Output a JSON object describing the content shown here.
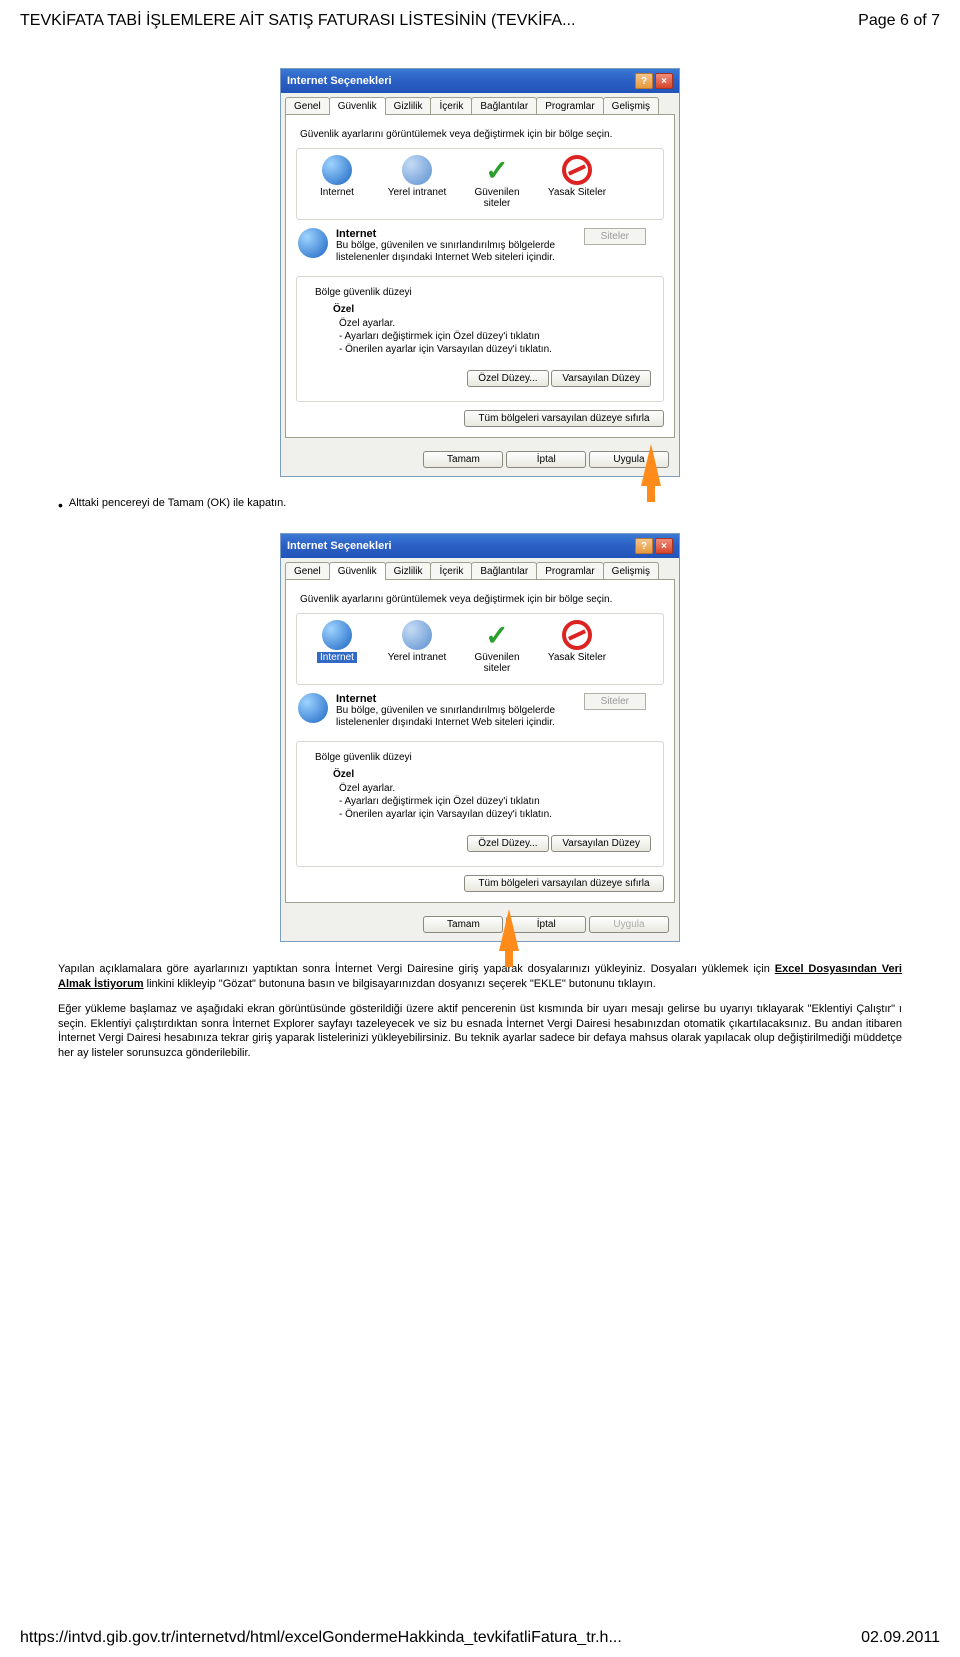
{
  "header": {
    "title": "TEVKİFATA TABİ İŞLEMLERE AİT SATIŞ FATURASI LİSTESİNİN (TEVKİFA...",
    "page_label": "Page 6 of 7"
  },
  "dialog": {
    "title": "Internet Seçenekleri",
    "help": "?",
    "close": "×",
    "tabs": [
      "Genel",
      "Güvenlik",
      "Gizlilik",
      "İçerik",
      "Bağlantılar",
      "Programlar",
      "Gelişmiş"
    ],
    "zone_instruction": "Güvenlik ayarlarını görüntülemek veya değiştirmek için bir bölge seçin.",
    "zones": [
      {
        "label": "Internet"
      },
      {
        "label": "Yerel intranet"
      },
      {
        "label": "Güvenilen siteler"
      },
      {
        "label": "Yasak Siteler"
      }
    ],
    "zone_detail": {
      "name": "Internet",
      "desc": "Bu bölge, güvenilen ve sınırlandırılmış bölgelerde listelenenler dışındaki Internet Web siteleri içindir."
    },
    "siteler_btn": "Siteler",
    "group_legend": "Bölge güvenlik düzeyi",
    "ozel_title": "Özel",
    "ozel_sub0": "Özel ayarlar.",
    "ozel_sub1": "- Ayarları değiştirmek için Özel düzey'i tıklatın",
    "ozel_sub2": "- Önerilen ayarlar için Varsayılan düzey'i tıklatın.",
    "btn_custom": "Özel Düzey...",
    "btn_default": "Varsayılan Düzey",
    "btn_reset": "Tüm bölgeleri varsayılan düzeye sıfırla",
    "btn_ok": "Tamam",
    "btn_cancel": "İptal",
    "btn_apply": "Uygula"
  },
  "bullet1": "Alttaki pencereyi de Tamam (OK) ile kapatın.",
  "para1_a": "Yapılan açıklamalara göre ayarlarınızı yaptıktan sonra İnternet Vergi Dairesine giriş yaparak dosyalarınızı yükleyiniz. Dosyaları yüklemek için ",
  "para1_link": "Excel Dosyasından Veri Almak İstiyorum",
  "para1_b": " linkini klikleyip \"Gözat\" butonuna basın ve bilgisayarınızdan dosyanızı seçerek \"EKLE\" butonunu tıklayın.",
  "para2": "Eğer yükleme başlamaz ve aşağıdaki ekran görüntüsünde gösterildiği üzere aktif pencerenin üst kısmında bir uyarı mesajı gelirse bu uyarıyı tıklayarak \"Eklentiyi Çalıştır\" ı seçin. Eklentiyi çalıştırdıktan sonra İnternet Explorer sayfayı tazeleyecek ve siz bu esnada İnternet Vergi Dairesi hesabınızdan otomatik çıkartılacaksınız. Bu andan itibaren İnternet Vergi Dairesi hesabınıza tekrar giriş yaparak listelerinizi yükleyebilirsiniz. Bu teknik ayarlar sadece bir defaya mahsus olarak yapılacak olup değiştirilmediği müddetçe her ay listeler sorunsuzca gönderilebilir.",
  "footer": {
    "url": "https://intvd.gib.gov.tr/internetvd/html/excelGondermeHakkinda_tevkifatliFatura_tr.h...",
    "date": "02.09.2011"
  }
}
